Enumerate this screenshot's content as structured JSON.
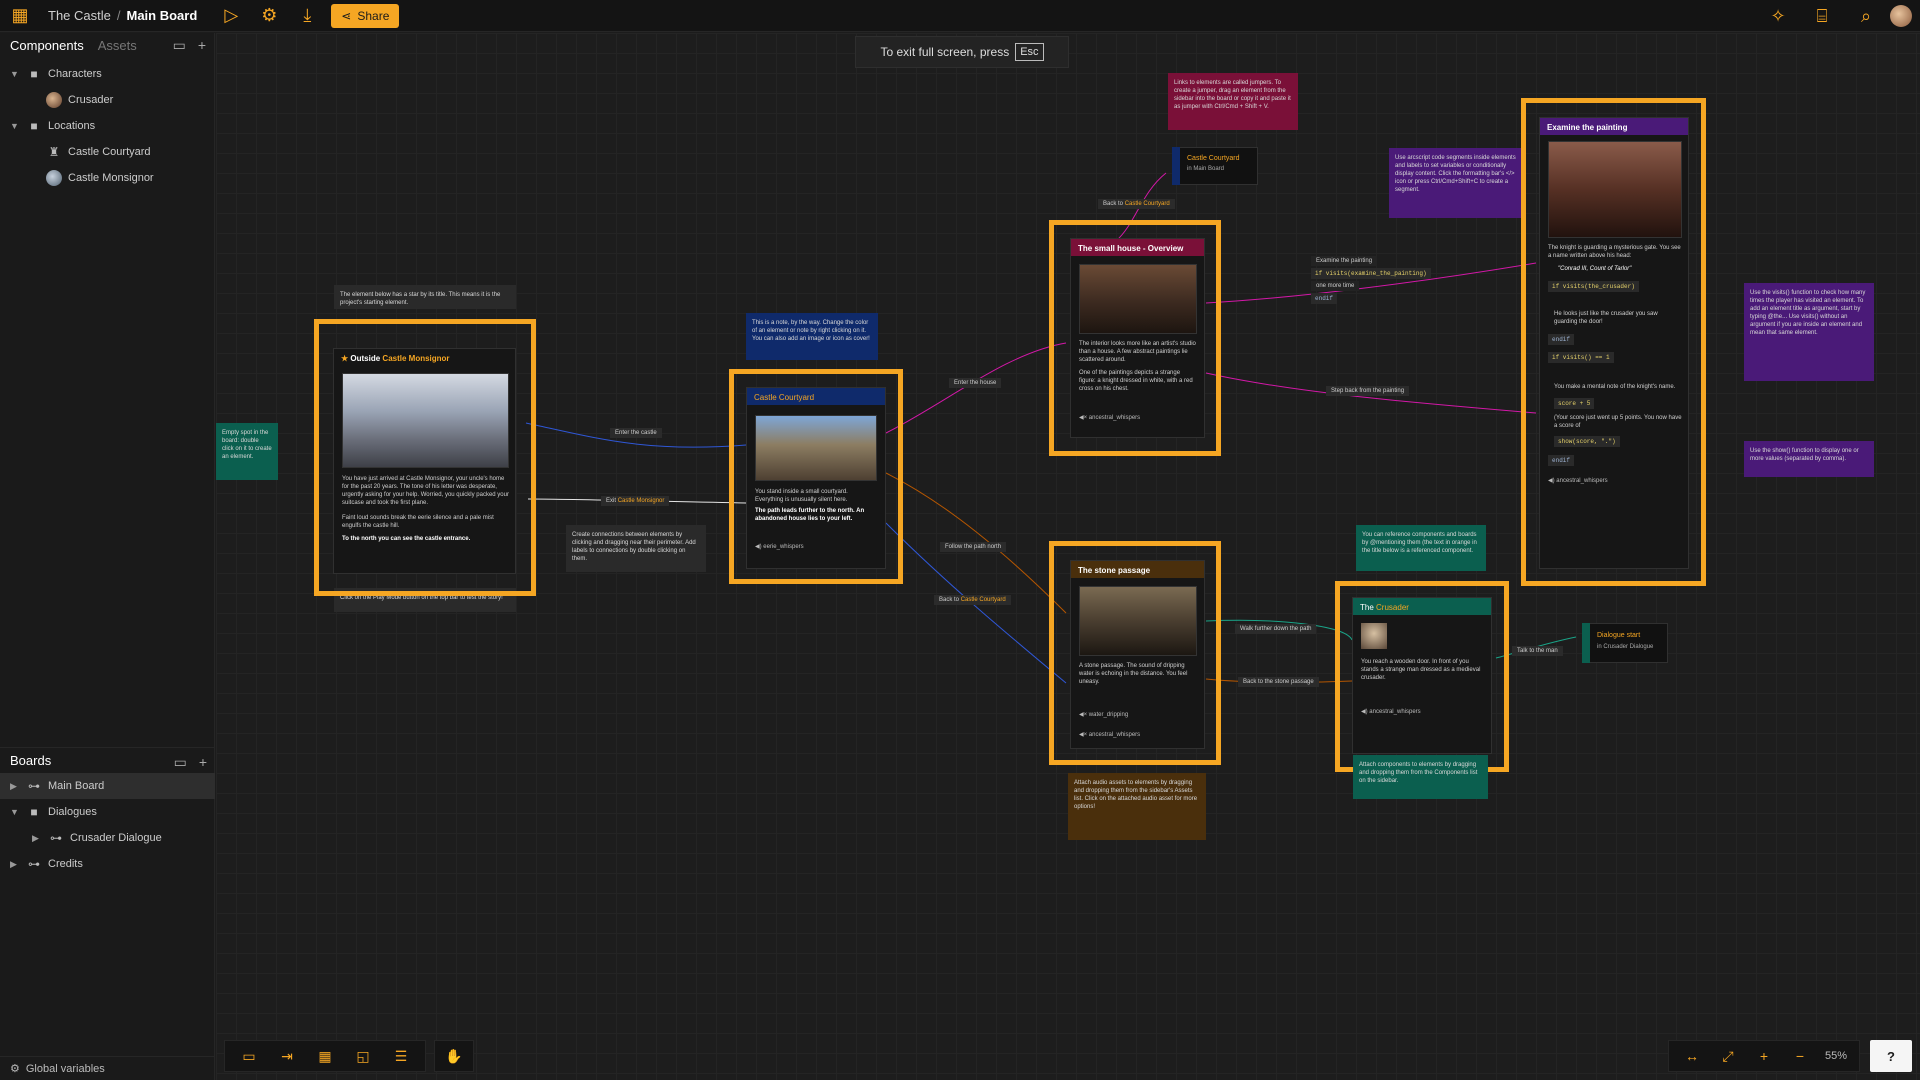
{
  "topbar": {
    "project": "The Castle",
    "separator": "/",
    "board": "Main Board",
    "share_label": "Share"
  },
  "sidebar": {
    "tabs": [
      "Components",
      "Assets"
    ],
    "components": {
      "folder_characters": "Characters",
      "crusader": "Crusader",
      "folder_locations": "Locations",
      "castle_courtyard": "Castle Courtyard",
      "castle_monsignor": "Castle Monsignor"
    },
    "boards_header": "Boards",
    "boards": {
      "main": "Main Board",
      "folder_dialogues": "Dialogues",
      "crusader_dialogue": "Crusader Dialogue",
      "credits": "Credits"
    },
    "global_variables": "Global variables"
  },
  "canvas": {
    "fullscreen_text": "To exit full screen, press",
    "fullscreen_key": "Esc",
    "cards": {
      "outside": {
        "title_prefix": "Outside",
        "title_link": "Castle Monsignor",
        "text1": "You have just arrived at Castle Monsignor, your uncle's home for the past 20 years. The tone of his letter was desperate, urgently asking for your help. Worried, you quickly packed your suitcase and took the first plane.",
        "text2": "Faint loud sounds break the eerie silence and a pale mist engulfs the castle hill.",
        "text3": "To the north you can see the castle entrance."
      },
      "courtyard": {
        "title": "Castle Courtyard",
        "text1": "You stand inside a small courtyard. Everything is unusually silent here.",
        "text2": "The path leads further to the north. An abandoned house lies to your left.",
        "audio": "eerie_whispers"
      },
      "small_house": {
        "title": "The small house - Overview",
        "text1": "The interior looks more like an artist's studio than a house. A few abstract paintings lie scattered around.",
        "text2": "One of the paintings depicts a strange figure: a knight dressed in white, with a red cross on his chest.",
        "audio": "ancestral_whispers"
      },
      "stone_passage": {
        "title": "The stone passage",
        "text1": "A stone passage. The sound of dripping water is echoing in the distance. You feel uneasy.",
        "audio1": "water_dripping",
        "audio2": "ancestral_whispers"
      },
      "crusader": {
        "title_prefix": "The",
        "title_link": "Crusader",
        "text1": "You reach a wooden door. In front of you stands a strange man dressed as a medieval crusader.",
        "audio": "ancestral_whispers"
      },
      "painting": {
        "title": "Examine the painting",
        "text1": "The knight is guarding a mysterious gate. You see a name written above his head:",
        "quote": "\"Conrad III, Count of Tarlor\"",
        "code1": "if visits(the_crusader)",
        "text2": "He looks just like the crusader you saw guarding the door!",
        "code2": "endif",
        "code3": "if visits() == 1",
        "text3": "You make a mental note of the knight's name.",
        "code4": "score + 5",
        "text4": "(Your score just went up 5 points. You now have a score of",
        "code5": "show(score, \".\")",
        "code6": "endif",
        "audio": "ancestral_whispers"
      },
      "jumper": {
        "title": "Castle Courtyard",
        "sub": "in Main Board"
      },
      "dialogue": {
        "title": "Dialogue start",
        "sub": "in Crusader Dialogue"
      }
    },
    "notes": {
      "start": "The element below has a star by its title. This means it is the project's starting element.",
      "play": "Click on the Play Mode button on the top bar to test the story!",
      "note_blue": "This is a note, by the way. Change the color of an element or note by right clicking on it. You can also add an image or icon as cover!",
      "connections": "Create connections between elements by clicking and dragging near their perimeter. Add labels to connections by double clicking on them.",
      "jumpers": "Links to elements are called jumpers. To create a jumper, drag an element from the sidebar into the board or copy it and paste it as jumper with Ctrl/Cmd + Shift + V.",
      "arcscript": "Use arcscript code segments inside elements and labels to set variables or conditionally display content. Click the formatting bar's </> icon or press Ctrl/Cmd+Shift+C to create a segment.",
      "references": "You can reference components and boards by @mentioning them (the text in orange in the title below is a referenced component.",
      "audio": "Attach audio assets to elements by dragging and dropping them from the sidebar's Assets list. Click on the attached audio asset for more options!",
      "components": "Attach components to elements by dragging and dropping them from the Components list on the sidebar.",
      "visits": "Use the visits() function to check how many times the player has visited an element. To add an element title as argument, start by typing @the... Use visits() without an argument if you are inside an element and mean that same element.",
      "show": "Use the show() function to display one or more values (separated by comma).",
      "left_green": "Empty spot in the board: double click on it to create an element."
    },
    "labels": {
      "enter_castle": "Enter the castle",
      "exit_prefix": "Exit",
      "exit_link": "Castle Monsignor",
      "enter_house": "Enter the house",
      "back_to_prefix": "Back to",
      "back_to_link": "Castle Courtyard",
      "follow_path": "Follow the path north",
      "back_to2_prefix": "Back to",
      "back_to2_link": "Castle Courtyard",
      "examine": "Examine the painting",
      "examine_code": "if visits(examine_the_painting)",
      "examine_more": "one more time",
      "examine_end": "endif",
      "step_back": "Step back from the painting",
      "walk_further": "Walk further down the path",
      "back_stone": "Back to the stone passage",
      "talk_man": "Talk to the man"
    },
    "zoom": "55%"
  },
  "colors": {
    "accent": "#f5a623",
    "crimson": "#7a1038",
    "navy": "#0f2a6b",
    "purple": "#4a1a78",
    "teal": "#0b5f4f",
    "brown": "#4a2f0c"
  }
}
